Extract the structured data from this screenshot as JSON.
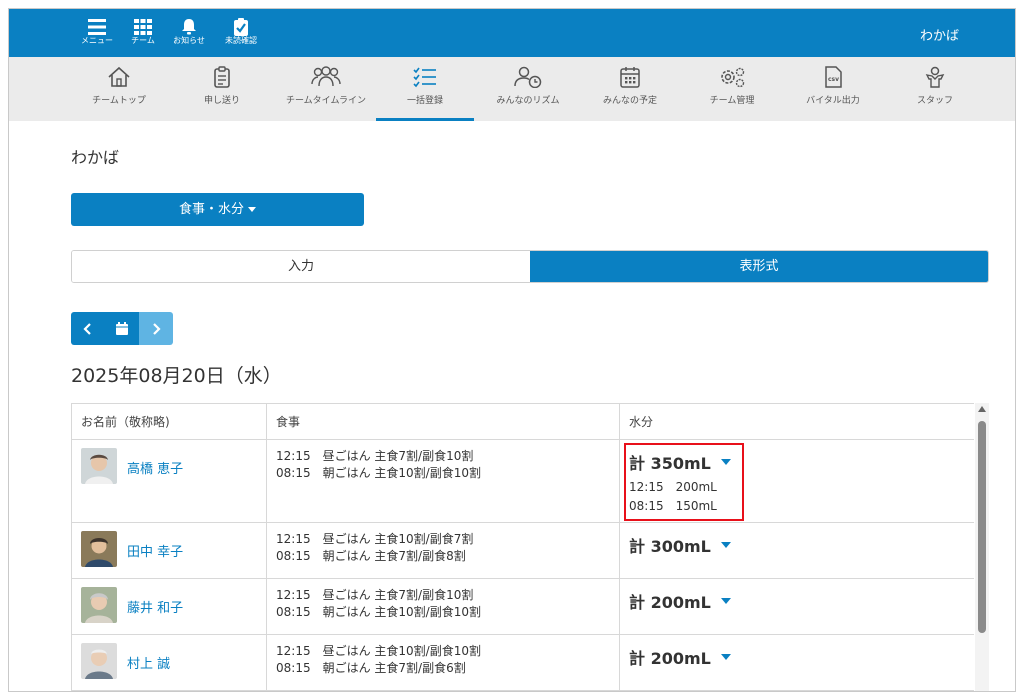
{
  "topbar": {
    "buttons": [
      {
        "label": "メニュー",
        "icon": "menu-icon"
      },
      {
        "label": "チーム",
        "icon": "grid-icon"
      },
      {
        "label": "お知らせ",
        "icon": "bell-icon"
      },
      {
        "label": "未読確認",
        "icon": "clipboard-check-icon"
      }
    ],
    "user": "わかば",
    "color": "#0a80c2"
  },
  "nav": {
    "items": [
      {
        "label": "チームトップ",
        "icon": "home-icon"
      },
      {
        "label": "申し送り",
        "icon": "clipboard-list-icon"
      },
      {
        "label": "チームタイムライン",
        "icon": "people-icon"
      },
      {
        "label": "一括登録",
        "icon": "checklist-icon",
        "active": true
      },
      {
        "label": "みんなのリズム",
        "icon": "person-clock-icon"
      },
      {
        "label": "みんなの予定",
        "icon": "calendar-icon"
      },
      {
        "label": "チーム管理",
        "icon": "gears-icon"
      },
      {
        "label": "バイタル出力",
        "icon": "csv-file-icon"
      },
      {
        "label": "スタッフ",
        "icon": "staff-icon"
      }
    ]
  },
  "team_name": "わかば",
  "category_dropdown": "食事・水分",
  "view_tabs": {
    "input": "入力",
    "table": "表形式",
    "active": "table"
  },
  "date": "2025年08月20日（水）",
  "table": {
    "headers": {
      "name": "お名前（敬称略)",
      "meal": "食事",
      "water": "水分"
    },
    "rows": [
      {
        "name": "高橋 恵子",
        "meals": [
          "12:15　昼ごはん 主食7割/副食10割",
          "08:15　朝ごはん 主食10割/副食10割"
        ],
        "water_total": "計 350mL",
        "water_detail": [
          "12:15　200mL",
          "08:15　150mL"
        ],
        "highlighted": true
      },
      {
        "name": "田中 幸子",
        "meals": [
          "12:15　昼ごはん 主食10割/副食7割",
          "08:15　朝ごはん 主食7割/副食8割"
        ],
        "water_total": "計 300mL"
      },
      {
        "name": "藤井 和子",
        "meals": [
          "12:15　昼ごはん 主食7割/副食10割",
          "08:15　朝ごはん 主食10割/副食10割"
        ],
        "water_total": "計 200mL"
      },
      {
        "name": "村上 誠",
        "meals": [
          "12:15　昼ごはん 主食10割/副食10割",
          "08:15　朝ごはん 主食7割/副食6割"
        ],
        "water_total": "計 200mL"
      }
    ]
  },
  "colors": {
    "accent": "#0a80c2",
    "highlight": "#e8101a"
  }
}
